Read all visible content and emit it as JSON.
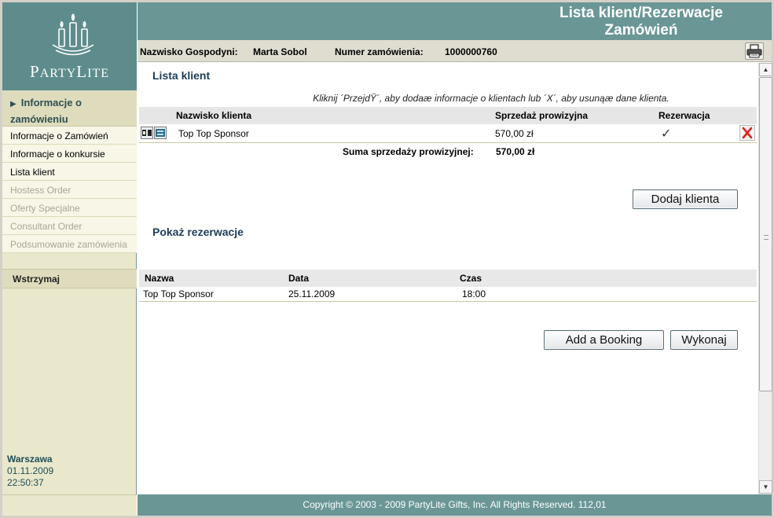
{
  "brand": {
    "logo_text_big": "P",
    "logo_text_rest": "ARTY",
    "logo_text_big2": "L",
    "logo_text_rest2": "ITE"
  },
  "header": {
    "title_line1": "Lista klient/Rezerwacje",
    "title_line2": "Zamówień"
  },
  "infobar": {
    "host_label": "Nazwisko Gospodyni:",
    "host_value": "Marta Sobol",
    "order_label": "Numer zamówienia:",
    "order_value": "1000000760",
    "print_icon": "printer-icon"
  },
  "sidebar": {
    "section_title": "Informacje o zamówieniu",
    "items": [
      {
        "label": "Informacje o Zamówień",
        "state": "active"
      },
      {
        "label": "Informacje o konkursie",
        "state": "active"
      },
      {
        "label": "Lista klient",
        "state": "active"
      },
      {
        "label": "Hostess Order",
        "state": "disabled"
      },
      {
        "label": "Oferty Specjalne",
        "state": "disabled"
      },
      {
        "label": "Consultant Order",
        "state": "disabled"
      },
      {
        "label": "Podsumowanie zamówienia",
        "state": "disabled"
      }
    ],
    "hold_label": "Wstrzymaj",
    "city": "Warszawa",
    "date": "01.11.2009",
    "time": "22:50:37"
  },
  "clients": {
    "title": "Lista klient",
    "hint": "Kliknij ´PrzejdŸ´, aby dodaæ informacje o klientach lub ´X´, aby usunąæ dane klienta.",
    "headers": {
      "name": "Nazwisko klienta",
      "sales": "Sprzedaż prowizyjna",
      "booking": "Rezerwacja"
    },
    "rows": [
      {
        "name": "Top  Top Sponsor",
        "sales": "570,00 zł",
        "booking_mark": "✓"
      }
    ],
    "total_label": "Suma sprzedaży prowizyjnej:",
    "total_value": "570,00 zł",
    "add_button": "Dodaj klienta"
  },
  "bookings": {
    "title": "Pokaż rezerwacje",
    "headers": {
      "name": "Nazwa",
      "date": "Data",
      "time": "Czas"
    },
    "rows": [
      {
        "name": "Top Top Sponsor",
        "date": "25.11.2009",
        "time": "18:00"
      }
    ],
    "add_button": "Add a Booking",
    "execute_button": "Wykonaj"
  },
  "footer": {
    "text": "Copyright © 2003 - 2009 PartyLite Gifts, Inc. All Rights Reserved.  112,01"
  },
  "colors": {
    "teal": "#6a9696",
    "sidebar_bg": "#e9e8cc",
    "title_blue": "#1f3c5a",
    "delete_red": "#e02020"
  }
}
